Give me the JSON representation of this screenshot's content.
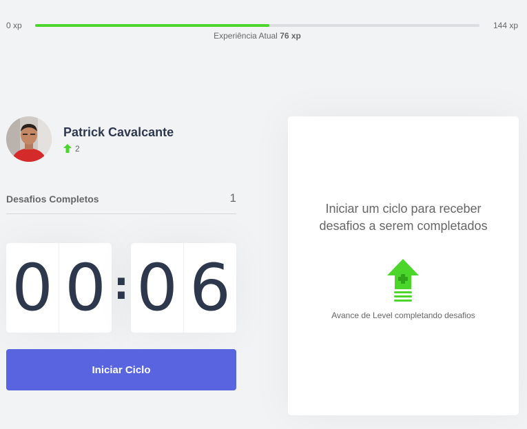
{
  "xp": {
    "min_label": "0 xp",
    "max_label": "144 xp",
    "current_label": "Experiência Atual",
    "current_value": "76 xp",
    "current": 76,
    "max": 144
  },
  "profile": {
    "name": "Patrick Cavalcante",
    "level": "2"
  },
  "challenges": {
    "label": "Desafios Completos",
    "count": "1"
  },
  "countdown": {
    "minute_left": "0",
    "minute_right": "0",
    "separator": ":",
    "second_left": "0",
    "second_right": "6"
  },
  "start_button": {
    "label": "Iniciar Ciclo"
  },
  "challenge_box": {
    "title": "Iniciar um ciclo para receber desafios a serem completados",
    "caption": "Avance de Level completando desafios",
    "icon": "level-up-icon"
  },
  "colors": {
    "accent_green": "#4cd62b",
    "button_blue": "#5965e0",
    "title_dark": "#2e384d"
  }
}
